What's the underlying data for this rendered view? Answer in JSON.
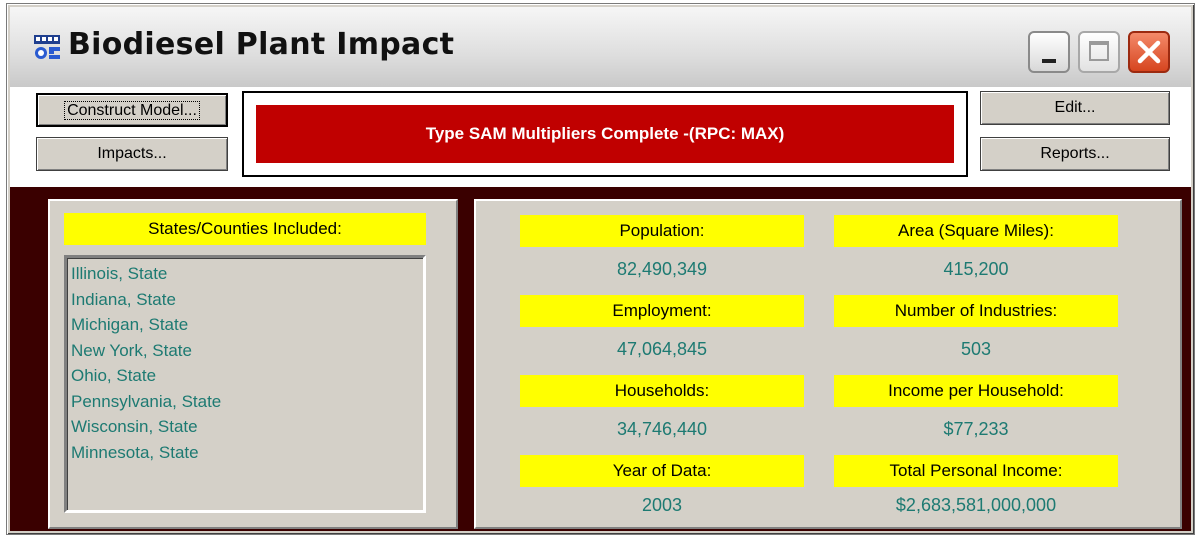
{
  "window": {
    "title": "Biodiesel Plant Impact",
    "app_icon": "iop-app-icon"
  },
  "toolbar": {
    "construct_label": "Construct Model...",
    "impacts_label": "Impacts...",
    "edit_label": "Edit...",
    "reports_label": "Reports...",
    "status_text": "Type SAM Multipliers Complete -(RPC: MAX)",
    "status_color": "#c00000"
  },
  "counties": {
    "header": "States/Counties Included:",
    "items": [
      "Illinois, State",
      "Indiana, State",
      "Michigan, State",
      "New York, State",
      "Ohio, State",
      "Pennsylvania, State",
      "Wisconsin, State",
      "Minnesota, State"
    ]
  },
  "stats": {
    "population_label": "Population:",
    "population_value": "82,490,349",
    "area_label": "Area (Square Miles):",
    "area_value": "415,200",
    "employment_label": "Employment:",
    "employment_value": "47,064,845",
    "industries_label": "Number of Industries:",
    "industries_value": "503",
    "households_label": "Households:",
    "households_value": "34,746,440",
    "income_hh_label": "Income per Household:",
    "income_hh_value": "$77,233",
    "year_label": "Year of Data:",
    "year_value": "2003",
    "total_income_label": "Total Personal Income:",
    "total_income_value": "$2,683,581,000,000"
  },
  "colors": {
    "label_bg": "#ffff00",
    "value_text": "#1d7a72",
    "body_bg": "#3a0000"
  }
}
